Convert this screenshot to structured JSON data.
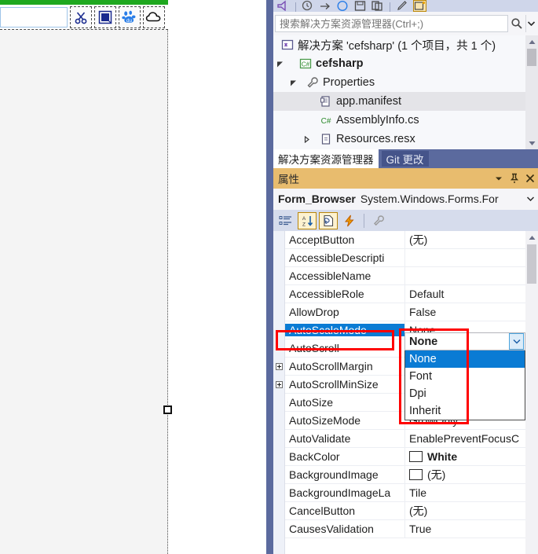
{
  "capture_overlay": {
    "input_value": "",
    "input_placeholder": "",
    "buttons": [
      {
        "name": "cut-icon",
        "label": ""
      },
      {
        "name": "select-region-icon",
        "label": ""
      },
      {
        "name": "baidu-logo-icon",
        "label": ""
      },
      {
        "name": "cloud-upload-icon",
        "label": ""
      }
    ]
  },
  "vs": {
    "toolbar_icons": [
      "megaphone-icon",
      "clock-icon",
      "arrow-right-icon",
      "circle-icon",
      "save-icon",
      "copy-icon",
      "pencil-icon",
      "window-icon"
    ],
    "solution_explorer": {
      "search_placeholder": "搜索解决方案资源管理器(Ctrl+;)",
      "search_value": "",
      "search_icon": "magnifier-icon",
      "dropdown_icon": "chevron-down-icon",
      "tree": [
        {
          "label": "解决方案 'cefsharp' (1 个项目，共 1 个)",
          "icon": "solution-icon",
          "indent": 0,
          "twisty": "",
          "bold": false,
          "selected": false
        },
        {
          "label": "cefsharp",
          "icon": "csharp-project-icon",
          "indent": 1,
          "twisty": "expanded",
          "bold": true,
          "selected": false
        },
        {
          "label": "Properties",
          "icon": "wrench-icon",
          "indent": 2,
          "twisty": "expanded",
          "bold": false,
          "selected": false
        },
        {
          "label": "app.manifest",
          "icon": "manifest-icon",
          "indent": 3,
          "twisty": "",
          "bold": false,
          "selected": true
        },
        {
          "label": "AssemblyInfo.cs",
          "icon": "csharp-file-icon",
          "indent": 3,
          "twisty": "",
          "bold": false,
          "selected": false
        },
        {
          "label": "Resources.resx",
          "icon": "resx-icon",
          "indent": 3,
          "twisty": "collapsed",
          "bold": false,
          "selected": false
        }
      ]
    },
    "panel_tabs": [
      {
        "label": "解决方案资源管理器",
        "active": true
      },
      {
        "label": "Git 更改",
        "active": false
      }
    ],
    "properties_panel": {
      "title": "属性",
      "header_buttons": [
        {
          "name": "dropdown-menu-icon"
        },
        {
          "name": "pin-icon"
        },
        {
          "name": "close-icon"
        }
      ],
      "object_name": "Form_Browser",
      "object_type": "System.Windows.Forms.For",
      "object_dropdown_icon": "chevron-down-icon",
      "toolbar_buttons": [
        {
          "name": "categorized-view-button",
          "pressed": false
        },
        {
          "name": "alphabetical-sort-button",
          "pressed": true
        },
        {
          "name": "properties-view-button",
          "pressed": true
        },
        {
          "name": "events-view-button",
          "pressed": false
        },
        {
          "name": "property-pages-button",
          "pressed": false,
          "disabled": true
        }
      ],
      "rows": [
        {
          "name": "AcceptButton",
          "value": "(无)",
          "expandable": false,
          "selected": false,
          "swatch": null,
          "bold": false
        },
        {
          "name": "AccessibleDescripti",
          "value": "",
          "expandable": false,
          "selected": false,
          "swatch": null,
          "bold": false
        },
        {
          "name": "AccessibleName",
          "value": "",
          "expandable": false,
          "selected": false,
          "swatch": null,
          "bold": false
        },
        {
          "name": "AccessibleRole",
          "value": "Default",
          "expandable": false,
          "selected": false,
          "swatch": null,
          "bold": false
        },
        {
          "name": "AllowDrop",
          "value": "False",
          "expandable": false,
          "selected": false,
          "swatch": null,
          "bold": false
        },
        {
          "name": "AutoScaleMode",
          "value": "None",
          "expandable": false,
          "selected": true,
          "swatch": null,
          "bold": false
        },
        {
          "name": "AutoScroll",
          "value": "",
          "expandable": false,
          "selected": false,
          "swatch": null,
          "bold": false
        },
        {
          "name": "AutoScrollMargin",
          "value": "",
          "expandable": true,
          "selected": false,
          "swatch": null,
          "bold": false
        },
        {
          "name": "AutoScrollMinSize",
          "value": "",
          "expandable": true,
          "selected": false,
          "swatch": null,
          "bold": false
        },
        {
          "name": "AutoSize",
          "value": "",
          "expandable": false,
          "selected": false,
          "swatch": null,
          "bold": false
        },
        {
          "name": "AutoSizeMode",
          "value": "GrowOnly",
          "expandable": false,
          "selected": false,
          "swatch": null,
          "bold": false
        },
        {
          "name": "AutoValidate",
          "value": "EnablePreventFocusC",
          "expandable": false,
          "selected": false,
          "swatch": null,
          "bold": false
        },
        {
          "name": "BackColor",
          "value": "White",
          "expandable": false,
          "selected": false,
          "swatch": "#ffffff",
          "bold": true
        },
        {
          "name": "BackgroundImage",
          "value": "(无)",
          "expandable": false,
          "selected": false,
          "swatch": "#ffffff",
          "bold": false
        },
        {
          "name": "BackgroundImageLa",
          "value": "Tile",
          "expandable": false,
          "selected": false,
          "swatch": null,
          "bold": false
        },
        {
          "name": "CancelButton",
          "value": "(无)",
          "expandable": false,
          "selected": false,
          "swatch": null,
          "bold": false
        },
        {
          "name": "CausesValidation",
          "value": "True",
          "expandable": false,
          "selected": false,
          "swatch": null,
          "bold": false
        }
      ],
      "open_combo": {
        "current_value": "None",
        "dropdown_icon": "chevron-down-icon",
        "options": [
          {
            "label": "None",
            "selected": true
          },
          {
            "label": "Font",
            "selected": false
          },
          {
            "label": "Dpi",
            "selected": false
          },
          {
            "label": "Inherit",
            "selected": false
          }
        ]
      }
    }
  },
  "annotations": {
    "accent_color": "#ff0000",
    "boxes": [
      {
        "name": "autoscalemode-property-highlight"
      },
      {
        "name": "autoscalemode-dropdown-highlight"
      }
    ]
  }
}
